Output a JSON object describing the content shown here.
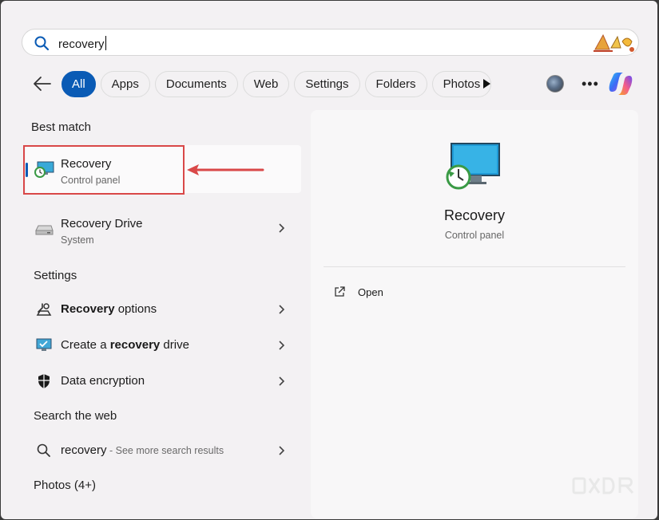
{
  "search": {
    "value": "recovery"
  },
  "filters": [
    "All",
    "Apps",
    "Documents",
    "Web",
    "Settings",
    "Folders",
    "Photos"
  ],
  "sections": {
    "best_match": "Best match",
    "settings": "Settings",
    "search_web": "Search the web",
    "photos": "Photos (4+)"
  },
  "best_match": {
    "title": "Recovery",
    "subtitle": "Control panel"
  },
  "recovery_drive": {
    "title_prefix": "Recovery",
    "title_suffix": " Drive",
    "subtitle": "System"
  },
  "settings_items": [
    {
      "bold": "Recovery",
      "rest": " options",
      "icon": "recovery-options-icon"
    },
    {
      "prefix": "Create a ",
      "bold": "recovery",
      "rest": " drive",
      "icon": "recovery-drive-settings-icon"
    },
    {
      "prefix": "Data encryption",
      "icon": "shield-icon"
    }
  ],
  "web_result": {
    "query": "recovery",
    "hint": " - See more search results"
  },
  "detail": {
    "title": "Recovery",
    "subtitle": "Control panel",
    "action": "Open"
  },
  "colors": {
    "accent": "#0a5bb5",
    "annotation": "#d94848"
  }
}
